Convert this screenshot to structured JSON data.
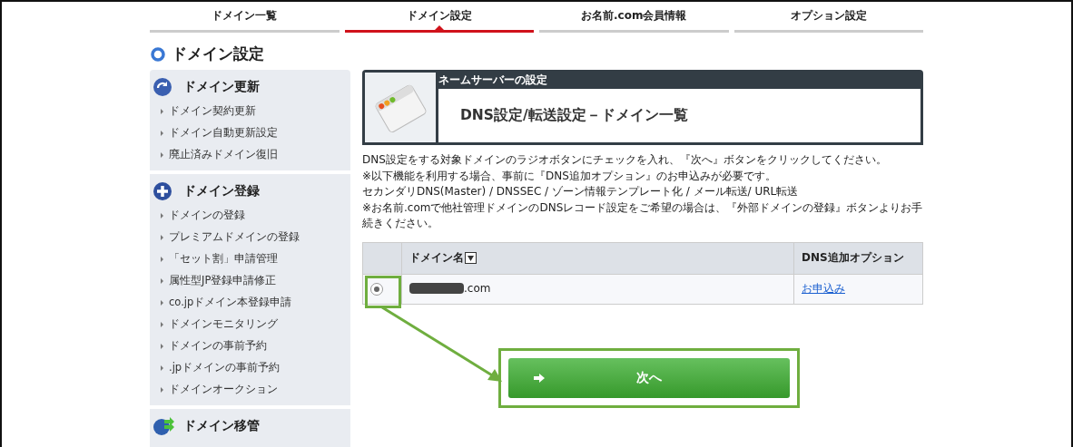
{
  "tabs": [
    {
      "label": "ドメイン一覧",
      "selected": false
    },
    {
      "label": "ドメイン設定",
      "selected": true
    },
    {
      "label": "お名前.com会員情報",
      "selected": false
    },
    {
      "label": "オプション設定",
      "selected": false
    }
  ],
  "page_title": "ドメイン設定",
  "sidebar": {
    "sections": [
      {
        "title": "ドメイン更新",
        "items": [
          "ドメイン契約更新",
          "ドメイン自動更新設定",
          "廃止済みドメイン復旧"
        ]
      },
      {
        "title": "ドメイン登録",
        "items": [
          "ドメインの登録",
          "プレミアムドメインの登録",
          "「セット割」申請管理",
          "属性型JP登録申請修正",
          "co.jpドメイン本登録申請",
          "ドメインモニタリング",
          "ドメインの事前予約",
          ".jpドメインの事前予約",
          "ドメインオークション"
        ]
      },
      {
        "title": "ドメイン移管"
      }
    ]
  },
  "panel": {
    "category": "ネームサーバーの設定",
    "title": "DNS設定/転送設定－ドメイン一覧"
  },
  "instructions": [
    "DNS設定をする対象ドメインのラジオボタンにチェックを入れ、『次へ』ボタンをクリックしてください。",
    "※以下機能を利用する場合、事前に『DNS追加オプション』のお申込みが必要です。",
    "セカンダリDNS(Master) / DNSSEC / ゾーン情報テンプレート化 / メール転送/ URL転送",
    "※お名前.comで他社管理ドメインのDNSレコード設定をご希望の場合は、『外部ドメインの登録』ボタンよりお手続きください。"
  ],
  "table": {
    "columns": [
      {
        "label": "ドメイン名",
        "sortable": true
      },
      {
        "label": "DNS追加オプション",
        "sortable": false
      }
    ],
    "rows": [
      {
        "selected": true,
        "domain": ".com",
        "redacted": true,
        "option_link": "お申込み"
      }
    ]
  },
  "next_button": {
    "label": "次へ"
  }
}
